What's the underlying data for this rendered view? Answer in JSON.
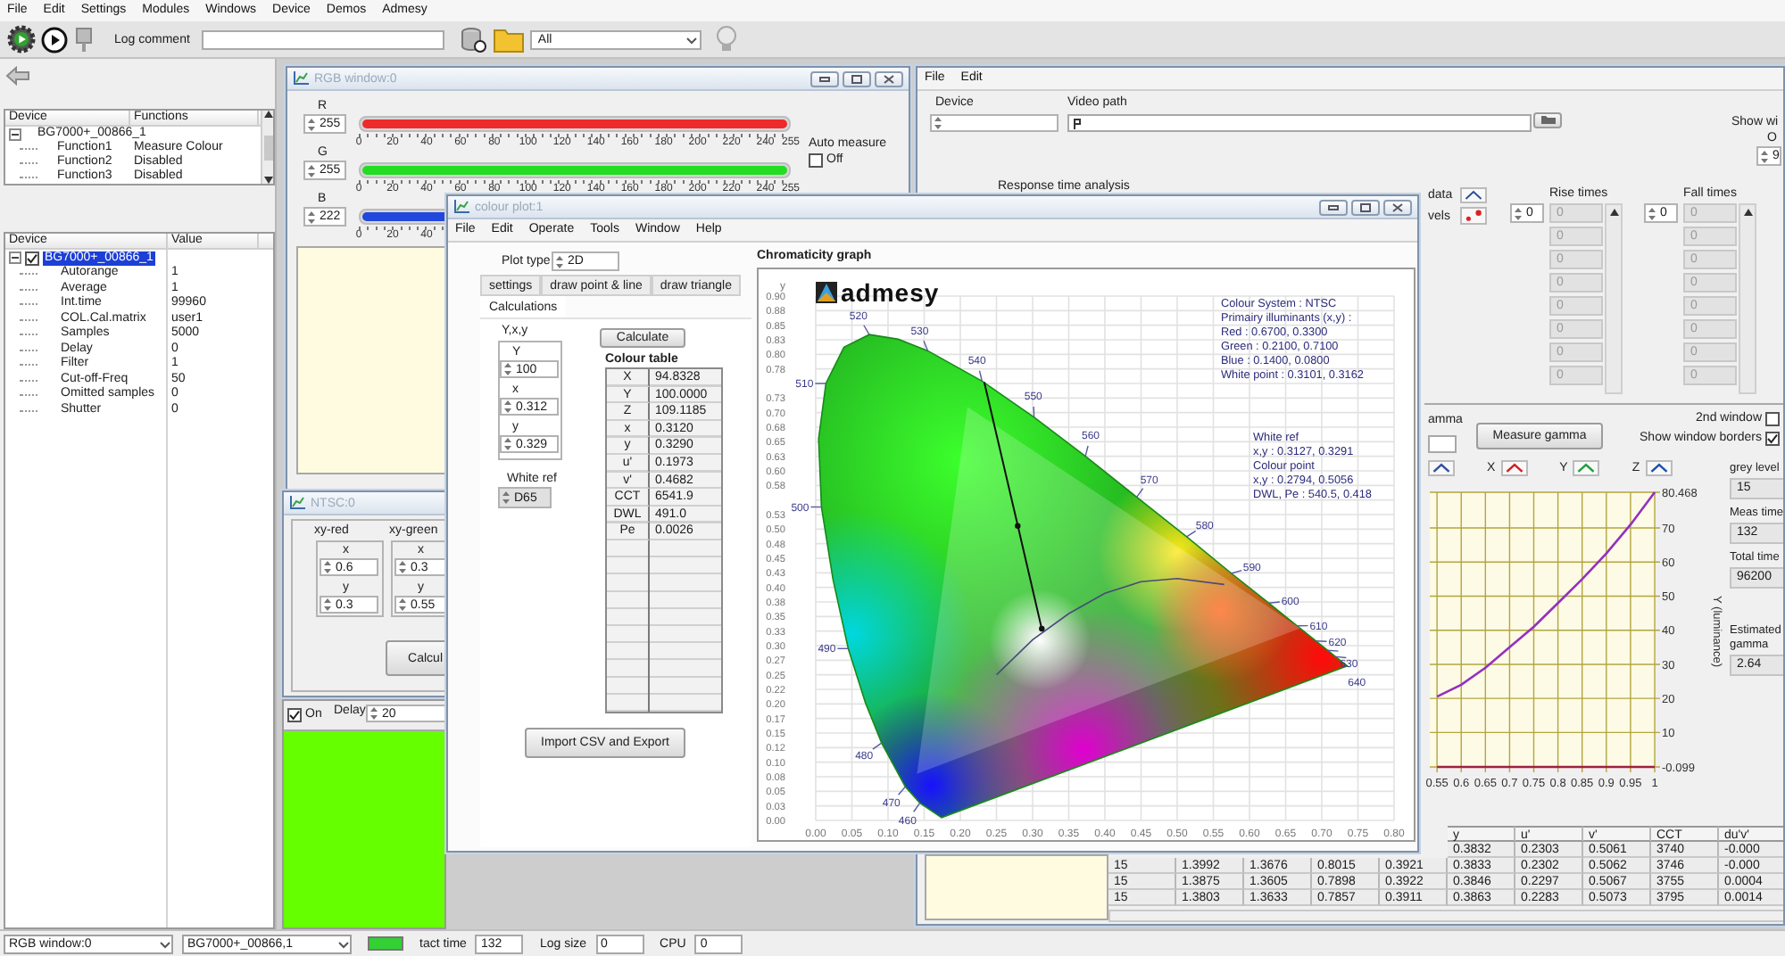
{
  "menu_bar": [
    "File",
    "Edit",
    "Settings",
    "Modules",
    "Windows",
    "Device",
    "Demos",
    "Admesy"
  ],
  "toolbar": {
    "log_comment_label": "Log comment",
    "filter": "All"
  },
  "device_functions": {
    "columns": [
      "Device",
      "Functions"
    ],
    "device": {
      "label": "BG7000+_00866_1",
      "expanded": true,
      "children": [
        {
          "label": "Function1",
          "value": "Measure Colour"
        },
        {
          "label": "Function2",
          "value": "Disabled"
        },
        {
          "label": "Function3",
          "value": "Disabled"
        }
      ]
    }
  },
  "device_settings": {
    "columns": [
      "Device",
      "Value"
    ],
    "device": {
      "label": "BG7000+_00866_1",
      "expanded": true,
      "checked": true,
      "selected": true,
      "children": [
        {
          "label": "Autorange",
          "value": "1"
        },
        {
          "label": "Average",
          "value": "1"
        },
        {
          "label": "Int.time",
          "value": "99960"
        },
        {
          "label": "COL.Cal.matrix",
          "value": "user1"
        },
        {
          "label": "Samples",
          "value": "5000"
        },
        {
          "label": "Delay",
          "value": "0"
        },
        {
          "label": "Filter",
          "value": "1"
        },
        {
          "label": "Cut-off-Freq",
          "value": "50"
        },
        {
          "label": "Omitted samples",
          "value": "0"
        },
        {
          "label": "Shutter",
          "value": "0"
        }
      ]
    }
  },
  "rgb_window": {
    "title": "RGB window:0",
    "sliders": [
      {
        "label": "R",
        "value": "255",
        "level": 1,
        "color": "#ee2a2a",
        "scale": [
          "0",
          "20",
          "40",
          "60",
          "80",
          "100",
          "120",
          "140",
          "160",
          "180",
          "200",
          "220",
          "240",
          "255"
        ]
      },
      {
        "label": "G",
        "value": "255",
        "level": 1,
        "color": "#22dd22",
        "scale": [
          "0",
          "20",
          "40",
          "60",
          "80",
          "100",
          "120",
          "140",
          "160",
          "180",
          "200",
          "220",
          "240",
          "255"
        ]
      },
      {
        "label": "B",
        "value": "222",
        "level": 0.87,
        "color": "#2247dd",
        "scale": [
          "0",
          "20",
          "40"
        ]
      }
    ],
    "auto_measure": {
      "label": "Auto measure",
      "option": "Off",
      "checked": false
    }
  },
  "ntsc_window": {
    "title": "NTSC:0",
    "groups": [
      {
        "label": "xy-red",
        "fields": [
          {
            "label": "x",
            "value": "0.6"
          },
          {
            "label": "y",
            "value": "0.3"
          }
        ]
      },
      {
        "label": "xy-green",
        "fields": [
          {
            "label": "x",
            "value": "0.3"
          },
          {
            "label": "y",
            "value": "0.55"
          }
        ]
      }
    ],
    "button": "Calcul"
  },
  "output": {
    "on_label": "On",
    "on": true,
    "delay_label": "Delay",
    "delay": "20"
  },
  "analysis_window": {
    "menu": [
      "File",
      "Edit"
    ],
    "device_label": "Device",
    "video_path_label": "Video path",
    "show_label": "Show wi",
    "option_label": "O",
    "option_value": "9",
    "response_label": "Response time analysis",
    "data_label": "data",
    "levels_label": "vels",
    "rise": {
      "label": "Rise times",
      "index": "0",
      "values": [
        "0",
        "0",
        "0",
        "0",
        "0",
        "0",
        "0",
        "0"
      ]
    },
    "fall": {
      "label": "Fall times",
      "index": "0",
      "values": [
        "0",
        "0",
        "0",
        "0",
        "0",
        "0",
        "0",
        "0"
      ]
    },
    "gamma": {
      "label": "amma",
      "button": "Measure gamma",
      "second_window": {
        "label": "2nd window",
        "checked": false
      },
      "borders": {
        "label": "Show window borders",
        "checked": true
      },
      "legend": [
        {
          "color": "#3050a0"
        },
        {
          "label": "X",
          "color": "#d02020"
        },
        {
          "label": "Y",
          "color": "#20a040"
        },
        {
          "label": "Z",
          "color": "#2050b0"
        }
      ],
      "chart_data": {
        "type": "line",
        "grid": true,
        "ylabel": "Y (luminance)",
        "x": [
          0.55,
          0.6,
          0.65,
          0.7,
          0.75,
          0.8,
          0.85,
          0.9,
          0.95,
          1
        ],
        "series": [
          {
            "color": "#9430c0",
            "values": [
              20.5,
              24,
              29,
              35,
              41,
              48,
              55,
              62.5,
              71,
              80.468
            ]
          },
          {
            "color": "#a02040",
            "values": [
              -0.099,
              -0.099,
              -0.099,
              -0.099,
              -0.099,
              -0.099,
              -0.099,
              -0.099,
              -0.099,
              -0.099
            ]
          }
        ],
        "xlim": [
          0.535,
          1
        ],
        "ylim": [
          -0.099,
          80.468
        ],
        "xticks": [
          {
            "value": 0.55,
            "label": "0.55"
          },
          {
            "value": 0.6,
            "label": "0.6"
          },
          {
            "value": 0.65,
            "label": "0.65"
          },
          {
            "value": 0.7,
            "label": "0.7"
          },
          {
            "value": 0.75,
            "label": "0.75"
          },
          {
            "value": 0.8,
            "label": "0.8"
          },
          {
            "value": 0.85,
            "label": "0.85"
          },
          {
            "value": 0.9,
            "label": "0.9"
          },
          {
            "value": 0.95,
            "label": "0.95"
          },
          {
            "value": 1,
            "label": "1"
          }
        ],
        "yticks": [
          {
            "value": -0.099,
            "label": "-0.099"
          },
          {
            "value": 10,
            "label": "10"
          },
          {
            "value": 20,
            "label": "20"
          },
          {
            "value": 30,
            "label": "30"
          },
          {
            "value": 40,
            "label": "40"
          },
          {
            "value": 50,
            "label": "50"
          },
          {
            "value": 60,
            "label": "60"
          },
          {
            "value": 70,
            "label": "70"
          },
          {
            "value": 80.468,
            "label": "80.468"
          }
        ]
      }
    },
    "readouts": [
      {
        "label": "grey level",
        "value": "15"
      },
      {
        "label": "Meas time",
        "value": "132"
      },
      {
        "label": "Total time",
        "value": "96200"
      },
      {
        "label": "Estimated gamma",
        "value": "2.64"
      }
    ],
    "table": {
      "columns": [
        "y",
        "u'",
        "v'",
        "CCT",
        "du'v'"
      ],
      "rows": [
        [
          "0.3832",
          "0.2303",
          "0.5061",
          "3740",
          "-0.000"
        ],
        [
          "15",
          "1.3992",
          "1.3676",
          "0.8015",
          "0.3921",
          "0.3833",
          "0.2302",
          "0.5062",
          "3746",
          "-0.000"
        ],
        [
          "15",
          "1.3875",
          "1.3605",
          "0.7898",
          "0.3922",
          "0.3846",
          "0.2297",
          "0.5067",
          "3755",
          "0.0004"
        ],
        [
          "15",
          "1.3803",
          "1.3633",
          "0.7857",
          "0.3911",
          "0.3863",
          "0.2283",
          "0.5073",
          "3795",
          "0.0014"
        ]
      ]
    }
  },
  "colour_plot": {
    "title": "colour plot:1",
    "menu": [
      "File",
      "Edit",
      "Operate",
      "Tools",
      "Window",
      "Help"
    ],
    "plot_type_label": "Plot type",
    "plot_type": "2D",
    "tabs": [
      {
        "label": "settings",
        "selected": false
      },
      {
        "label": "draw point & line",
        "selected": false
      },
      {
        "label": "draw triangle",
        "selected": false
      },
      {
        "label": "Calculations",
        "selected": true
      }
    ],
    "input_group": {
      "label": "Y,x,y",
      "fields": [
        {
          "label": "Y",
          "value": "100"
        },
        {
          "label": "x",
          "value": "0.312"
        },
        {
          "label": "y",
          "value": "0.329"
        }
      ]
    },
    "white_ref_label": "White ref",
    "white_ref": "D65",
    "calculate_button": "Calculate",
    "colour_table": {
      "label": "Colour table",
      "rows": [
        [
          "X",
          "94.8328"
        ],
        [
          "Y",
          "100.0000"
        ],
        [
          "Z",
          "109.1185"
        ],
        [
          "x",
          "0.3120"
        ],
        [
          "y",
          "0.3290"
        ],
        [
          "u'",
          "0.1973"
        ],
        [
          "v'",
          "0.4682"
        ],
        [
          "CCT",
          "6541.9"
        ],
        [
          "DWL",
          "491.0"
        ],
        [
          "Pe",
          "0.0026"
        ]
      ]
    },
    "import_button": "Import CSV and Export",
    "graph": {
      "logo": "admesy",
      "chart_data": {
        "type": "area",
        "grid": true,
        "title": "Chromaticity graph",
        "ylabel": "y",
        "x": [
          0.174,
          0.144,
          0.124,
          0.091,
          0.069,
          0.045,
          0.024,
          0.008,
          0.004,
          0.014,
          0.039,
          0.074,
          0.114,
          0.155,
          0.23,
          0.302,
          0.373,
          0.444,
          0.513,
          0.575,
          0.627,
          0.666,
          0.692,
          0.708,
          0.719,
          0.735
        ],
        "series": [
          {
            "color": "#178a17",
            "values": [
              0.005,
              0.03,
              0.058,
              0.133,
              0.201,
              0.295,
              0.413,
              0.538,
              0.655,
              0.75,
              0.812,
              0.834,
              0.826,
              0.806,
              0.754,
              0.692,
              0.625,
              0.555,
              0.487,
              0.424,
              0.373,
              0.334,
              0.308,
              0.292,
              0.281,
              0.265
            ]
          }
        ],
        "value_labels": [
          null,
          "460",
          "470",
          "480",
          null,
          "490",
          null,
          "500",
          null,
          "510",
          null,
          "520",
          null,
          "530",
          "540",
          "550",
          "560",
          "570",
          "580",
          "590",
          "600",
          "610",
          "620",
          "630",
          "640",
          null
        ],
        "xlim": [
          0,
          0.8
        ],
        "ylim": [
          0,
          0.9
        ],
        "xticks": [
          {
            "value": 0,
            "label": "0.00"
          },
          {
            "value": 0.05,
            "label": "0.05"
          },
          {
            "value": 0.1,
            "label": "0.10"
          },
          {
            "value": 0.15,
            "label": "0.15"
          },
          {
            "value": 0.2,
            "label": "0.20"
          },
          {
            "value": 0.25,
            "label": "0.25"
          },
          {
            "value": 0.3,
            "label": "0.30"
          },
          {
            "value": 0.35,
            "label": "0.35"
          },
          {
            "value": 0.4,
            "label": "0.40"
          },
          {
            "value": 0.45,
            "label": "0.45"
          },
          {
            "value": 0.5,
            "label": "0.50"
          },
          {
            "value": 0.55,
            "label": "0.55"
          },
          {
            "value": 0.6,
            "label": "0.60"
          },
          {
            "value": 0.65,
            "label": "0.65"
          },
          {
            "value": 0.7,
            "label": "0.70"
          },
          {
            "value": 0.75,
            "label": "0.75"
          },
          {
            "value": 0.8,
            "label": "0.80"
          }
        ],
        "yticks": [
          {
            "value": 0,
            "label": "0.00"
          },
          {
            "value": 0.025,
            "label": "0.03"
          },
          {
            "value": 0.05,
            "label": "0.05"
          },
          {
            "value": 0.075,
            "label": "0.08"
          },
          {
            "value": 0.1,
            "label": "0.10"
          },
          {
            "value": 0.125,
            "label": "0.12"
          },
          {
            "value": 0.15,
            "label": "0.15"
          },
          {
            "value": 0.175,
            "label": "0.17"
          },
          {
            "value": 0.2,
            "label": "0.20"
          },
          {
            "value": 0.225,
            "label": "0.22"
          },
          {
            "value": 0.25,
            "label": "0.25"
          },
          {
            "value": 0.275,
            "label": "0.27"
          },
          {
            "value": 0.3,
            "label": "0.30"
          },
          {
            "value": 0.325,
            "label": "0.33"
          },
          {
            "value": 0.35,
            "label": "0.35"
          },
          {
            "value": 0.375,
            "label": "0.38"
          },
          {
            "value": 0.4,
            "label": "0.40"
          },
          {
            "value": 0.425,
            "label": "0.43"
          },
          {
            "value": 0.45,
            "label": "0.45"
          },
          {
            "value": 0.475,
            "label": "0.48"
          },
          {
            "value": 0.5,
            "label": "0.50"
          },
          {
            "value": 0.525,
            "label": "0.53"
          },
          {
            "value": 0.575,
            "label": "0.58"
          },
          {
            "value": 0.6,
            "label": "0.60"
          },
          {
            "value": 0.625,
            "label": "0.63"
          },
          {
            "value": 0.65,
            "label": "0.65"
          },
          {
            "value": 0.675,
            "label": "0.68"
          },
          {
            "value": 0.7,
            "label": "0.70"
          },
          {
            "value": 0.725,
            "label": "0.73"
          },
          {
            "value": 0.775,
            "label": "0.78"
          },
          {
            "value": 0.8,
            "label": "0.80"
          },
          {
            "value": 0.825,
            "label": "0.83"
          },
          {
            "value": 0.85,
            "label": "0.85"
          },
          {
            "value": 0.875,
            "label": "0.88"
          },
          {
            "value": 0.9,
            "label": "0.90"
          }
        ],
        "annotations": [
          {
            "text": "Colour System : NTSC"
          },
          {
            "text": "Primairy illuminants (x,y) :"
          },
          {
            "text": "Red : 0.6700, 0.3300"
          },
          {
            "text": "Green : 0.2100, 0.7100"
          },
          {
            "text": "Blue : 0.1400, 0.0800"
          },
          {
            "text": "White point  : 0.3101, 0.3162"
          },
          {
            "text": "White ref"
          },
          {
            "text": "x,y : 0.3127, 0.3291"
          },
          {
            "text": "Colour point"
          },
          {
            "text": "x,y : 0.2794, 0.5056"
          },
          {
            "text": "DWL, Pe : 540.5, 0.418"
          }
        ]
      }
    }
  },
  "status_bar": {
    "window_select": "RGB window:0",
    "device_select": "BG7000+_00866,1",
    "busy": true,
    "tact_label": "tact time",
    "tact": "132",
    "log_size_label": "Log size",
    "log_size": "0",
    "cpu_label": "CPU",
    "cpu": "0"
  }
}
